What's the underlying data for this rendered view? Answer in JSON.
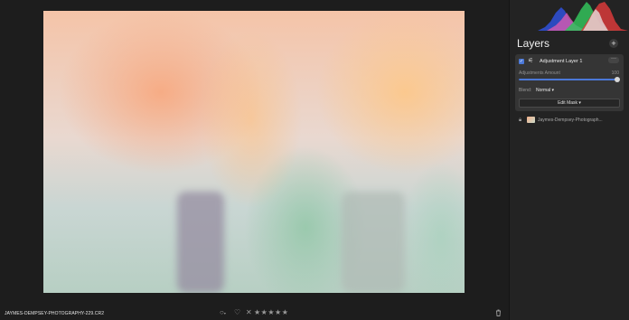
{
  "image": {
    "description_icon": "tulip-photo"
  },
  "status_bar": {
    "filename": "JAYMES-DEMPSEY-PHOTOGRAPHY-229.CR2",
    "color_label_icon": "circle-icon",
    "color_label_caret": "▾",
    "favorite_icon": "heart-icon",
    "reject_icon": "x-icon",
    "rating": 0,
    "max_rating": 5,
    "delete_icon": "trash-icon"
  },
  "panel": {
    "title": "Layers",
    "add_icon": "+",
    "adjustment_layer": {
      "checked": true,
      "name": "Adjustment Layer 1",
      "more_icon": "···",
      "amount_label": "Adjustments Amount",
      "amount_value": "100",
      "amount_fraction": 1.0,
      "blend_label": "Blend:",
      "blend_value": "Normal ▾",
      "edit_mask_label": "Edit Mask ▾"
    },
    "base_layer": {
      "name": "Jaymes-Dempsey-Photograph..."
    }
  },
  "colors": {
    "accent": "#4b78d8",
    "panel_bg": "#232323",
    "app_bg": "#1c1c1c"
  }
}
